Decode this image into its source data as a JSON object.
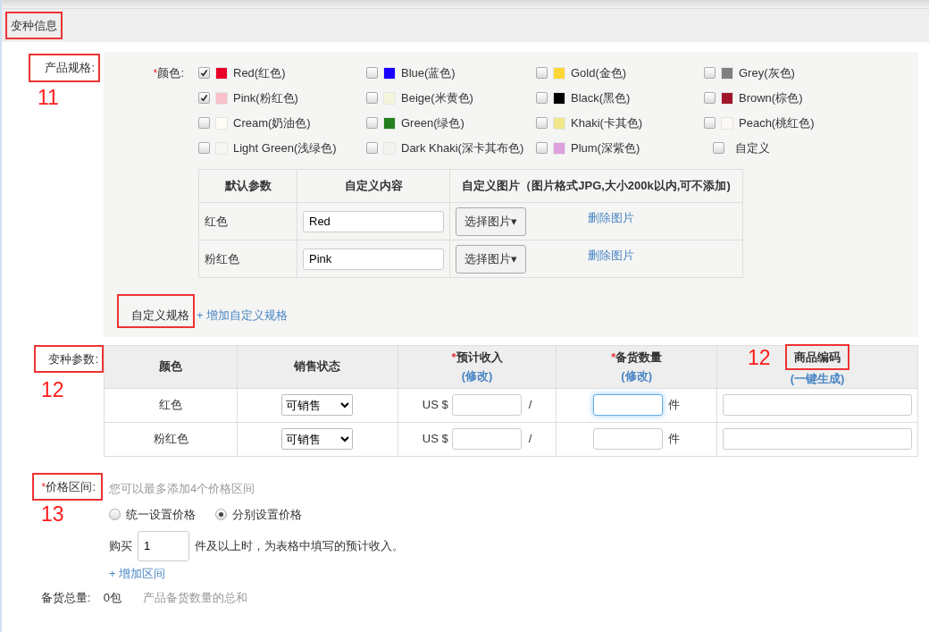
{
  "section_title": {
    "text": "变种信息",
    "highlighted": true
  },
  "specs": {
    "label": "产品规格:",
    "highlighted": true,
    "annotation": "11",
    "color_field": {
      "label": "颜色:",
      "required_mark": "*",
      "options": [
        {
          "label": "Red(红色)",
          "kind": "swatch",
          "color": "#e8002a",
          "checked": true
        },
        {
          "label": "Blue(蓝色)",
          "kind": "swatch",
          "color": "#1a00ff",
          "checked": false
        },
        {
          "label": "Gold(金色)",
          "kind": "swatch",
          "color": "#fdd835",
          "checked": false
        },
        {
          "label": "Grey(灰色)",
          "kind": "swatch",
          "color": "#808080",
          "checked": false
        },
        {
          "label": "Pink(粉红色)",
          "kind": "swatch",
          "color": "#f9c0cb",
          "checked": true
        },
        {
          "label": "Beige(米黄色)",
          "kind": "swatch",
          "color": "#f5f5dc",
          "checked": false
        },
        {
          "label": "Black(黑色)",
          "kind": "swatch",
          "color": "#000000",
          "checked": false
        },
        {
          "label": "Brown(棕色)",
          "kind": "swatch",
          "color": "#a0152a",
          "checked": false
        },
        {
          "label": "Cream(奶油色)",
          "kind": "swatch",
          "color": "#fffdf5",
          "checked": false
        },
        {
          "label": "Green(绿色)",
          "kind": "swatch",
          "color": "#22801e",
          "checked": false
        },
        {
          "label": "Khaki(卡其色)",
          "kind": "swatch",
          "color": "#f0e68c",
          "checked": false
        },
        {
          "label": "Peach(桃红色)",
          "kind": "swatch",
          "color": "#fbf8f5",
          "checked": false
        },
        {
          "label": "Light Green(浅绿色)",
          "kind": "swatch",
          "color": "#f6f6f4",
          "checked": false
        },
        {
          "label": "Dark Khaki(深卡其布色)",
          "kind": "swatch",
          "color": "#f3f3f1",
          "checked": false
        },
        {
          "label": "Plum(深紫色)",
          "kind": "swatch",
          "color": "#dda0dd",
          "checked": false
        },
        {
          "label": "自定义",
          "kind": "custom",
          "checked": false
        }
      ]
    },
    "param_table": {
      "columns": [
        "默认参数",
        "自定义内容",
        "自定义图片（图片格式JPG,大小200k以内,可不添加)"
      ],
      "rows": [
        {
          "default": "红色",
          "value": "Red",
          "button": "选择图片▾",
          "delete_link": "删除图片"
        },
        {
          "default": "粉红色",
          "value": "Pink",
          "button": "选择图片▾",
          "delete_link": "删除图片"
        }
      ]
    },
    "custom_spec": {
      "label": "自定义规格",
      "highlighted": true,
      "add_link": "+ 增加自定义规格"
    }
  },
  "variants": {
    "label": "变种参数:",
    "highlighted": true,
    "annotation": "12",
    "columns": [
      {
        "label": "颜色",
        "highlighted": false
      },
      {
        "label": "销售状态",
        "highlighted": false
      },
      {
        "label": "预计收入",
        "required_mark": "*",
        "highlighted": false,
        "link": "(修改)"
      },
      {
        "label": "备货数量",
        "required_mark": "*",
        "highlighted": false,
        "link": "(修改)"
      },
      {
        "label": "商品编码",
        "highlighted": true,
        "annotation": "12",
        "link": "(一键生成)"
      }
    ],
    "rows": [
      {
        "color_name": "红色",
        "status": "可销售",
        "currency": "US $",
        "separator": "/",
        "unit": "件",
        "focused": true
      },
      {
        "color_name": "粉红色",
        "status": "可销售",
        "currency": "US $",
        "separator": "/",
        "unit": "件",
        "focused": false
      }
    ]
  },
  "price": {
    "label": "价格区间:",
    "required_mark": "*",
    "highlighted": true,
    "annotation": "13",
    "hint": "您可以最多添加4个价格区间",
    "options": [
      {
        "label": "统一设置价格",
        "selected": false
      },
      {
        "label": "分别设置价格",
        "selected": true
      }
    ],
    "buy_prefix": "购买",
    "quantity": "1",
    "buy_suffix": "件及以上时，为表格中填写的预计收入。",
    "add_link": "+ 增加区间"
  },
  "stock": {
    "label": "备货总量:",
    "value": "0包",
    "hint": "产品备货数量的总和"
  }
}
